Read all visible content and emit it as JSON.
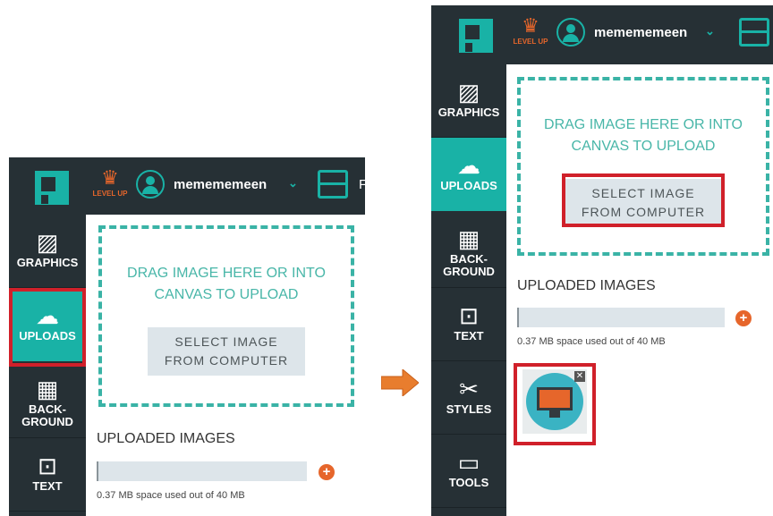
{
  "app": {
    "level_label": "LEVEL UP",
    "username": "memememeen",
    "truncated_text": "F",
    "crown_icon": "crown-icon",
    "avatar_icon": "user-circle-icon",
    "chevron_icon": "chevron-down-icon",
    "tools_icon": "toolbox-icon"
  },
  "sidebar": {
    "items": [
      {
        "label": "GRAPHICS",
        "icon": "image-icon"
      },
      {
        "label": "UPLOADS",
        "icon": "cloud-upload-icon"
      },
      {
        "label_line1": "BACK-",
        "label_line2": "GROUND",
        "icon": "background-icon"
      },
      {
        "label": "TEXT",
        "icon": "text-icon"
      },
      {
        "label": "STYLES",
        "icon": "styles-icon"
      },
      {
        "label": "TOOLS",
        "icon": "toolbox-icon"
      }
    ]
  },
  "upload": {
    "drop_line1": "DRAG IMAGE HERE OR INTO",
    "drop_line2": "CANVAS TO UPLOAD",
    "select_line1": "SELECT IMAGE",
    "select_line2": "FROM COMPUTER",
    "uploaded_title": "UPLOADED IMAGES",
    "space_used": "0.37 MB space used out of 40 MB",
    "storage_used_fraction": 0.009
  },
  "colors": {
    "accent": "#19b2a6",
    "dark": "#263035",
    "orange": "#e6662b",
    "highlight": "#d0202a"
  }
}
